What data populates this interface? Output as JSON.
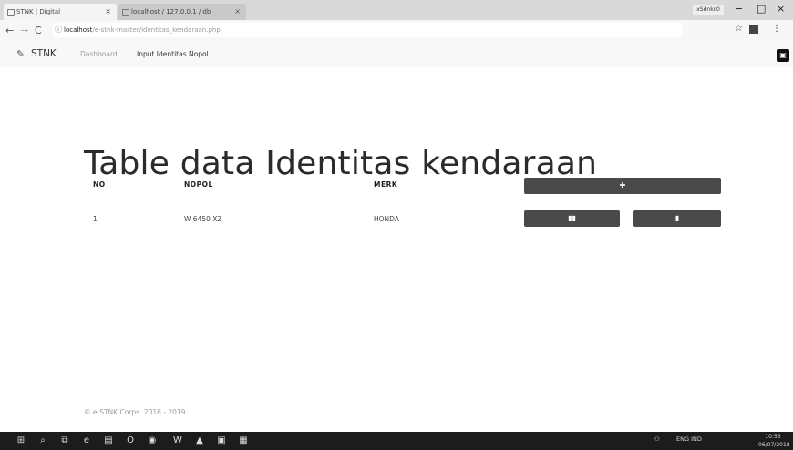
{
  "browser": {
    "tabs": [
      {
        "title": "STNK | Digital",
        "close": "×"
      },
      {
        "title": "localhost / 127.0.0.1 / db",
        "close": "×"
      }
    ],
    "window_user": "xSdnkc0",
    "url_host": "localhost",
    "url_path": "/e-stnk-master/identitas_kendaraan.php"
  },
  "app": {
    "brand": "STNK",
    "nav": {
      "dashboard": "Dashboard",
      "input": "Input Identitas Nopol"
    }
  },
  "page": {
    "title": "Table data Identitas kendaraan"
  },
  "table": {
    "headers": {
      "no": "NO",
      "nopol": "NOPOL",
      "merk": "MERK"
    },
    "rows": [
      {
        "no": "1",
        "nopol": "W 6450 XZ",
        "merk": "HONDA"
      }
    ]
  },
  "buttons": {
    "add_icon": "plus-icon",
    "edit_icon": "book-icon",
    "delete_icon": "trash-icon"
  },
  "footer": {
    "text": "© e-STNK Corps. 2018 - 2019"
  },
  "taskbar": {
    "tray_text": "ENG IND",
    "time": "10:53",
    "date": "06/07/2018"
  }
}
